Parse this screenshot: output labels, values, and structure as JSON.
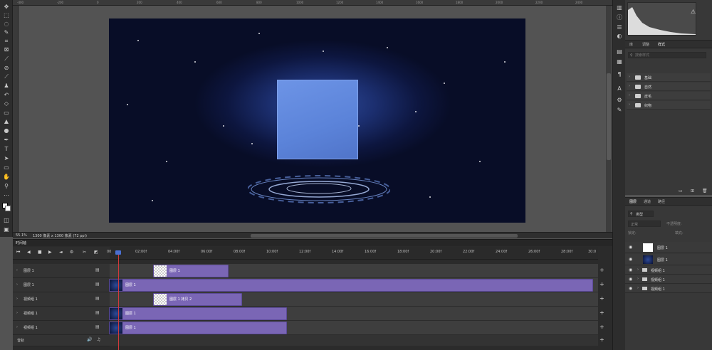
{
  "ruler": {
    "ticks": [
      "-400",
      "-200",
      "0",
      "200",
      "400",
      "600",
      "800",
      "1000",
      "1200",
      "1400",
      "1600",
      "1800",
      "2000",
      "2200",
      "2400"
    ]
  },
  "status": {
    "zoom": "55.1%",
    "doc_info": "1300 像素 x 1300 像素 (72 ppi)"
  },
  "histogram": {
    "warning_icon": "warning-icon"
  },
  "styles_panel": {
    "tabs": [
      "库",
      "调整",
      "样式"
    ],
    "active_tab": "样式",
    "search_placeholder": "搜索样式",
    "folders": [
      "基础",
      "自然",
      "皮毛",
      "织物"
    ]
  },
  "layers_panel": {
    "tabs": [
      "图层",
      "通道",
      "路径"
    ],
    "filter_kind": "类型",
    "blend_mode": "正常",
    "opacity_label": "不透明度:",
    "lock_label": "锁定:",
    "fill_label": "填充:",
    "layers": [
      {
        "name": "图层 1"
      },
      {
        "name": "图层 1"
      },
      {
        "name": "视频组 1"
      },
      {
        "name": "视频组 1"
      },
      {
        "name": "视频组 1"
      }
    ]
  },
  "timeline": {
    "tab_label": "时间轴",
    "time_marks": [
      "00",
      "02:00f",
      "04:00f",
      "06:00f",
      "08:00f",
      "10:00f",
      "12:00f",
      "14:00f",
      "16:00f",
      "18:00f",
      "20:00f",
      "22:00f",
      "24:00f",
      "26:00f",
      "28:00f",
      "30:0"
    ],
    "tracks": [
      {
        "label": "图层 1",
        "clip_label": "图层 1"
      },
      {
        "label": "图层 1",
        "clip_label": "图层 1"
      },
      {
        "label": "视频组 1",
        "clip_label": "图层 1 拷贝 2"
      },
      {
        "label": "视频组 1",
        "clip_label": "图层 1"
      },
      {
        "label": "视频组 1",
        "clip_label": "图层 1"
      }
    ],
    "audio_label": "音轨"
  }
}
